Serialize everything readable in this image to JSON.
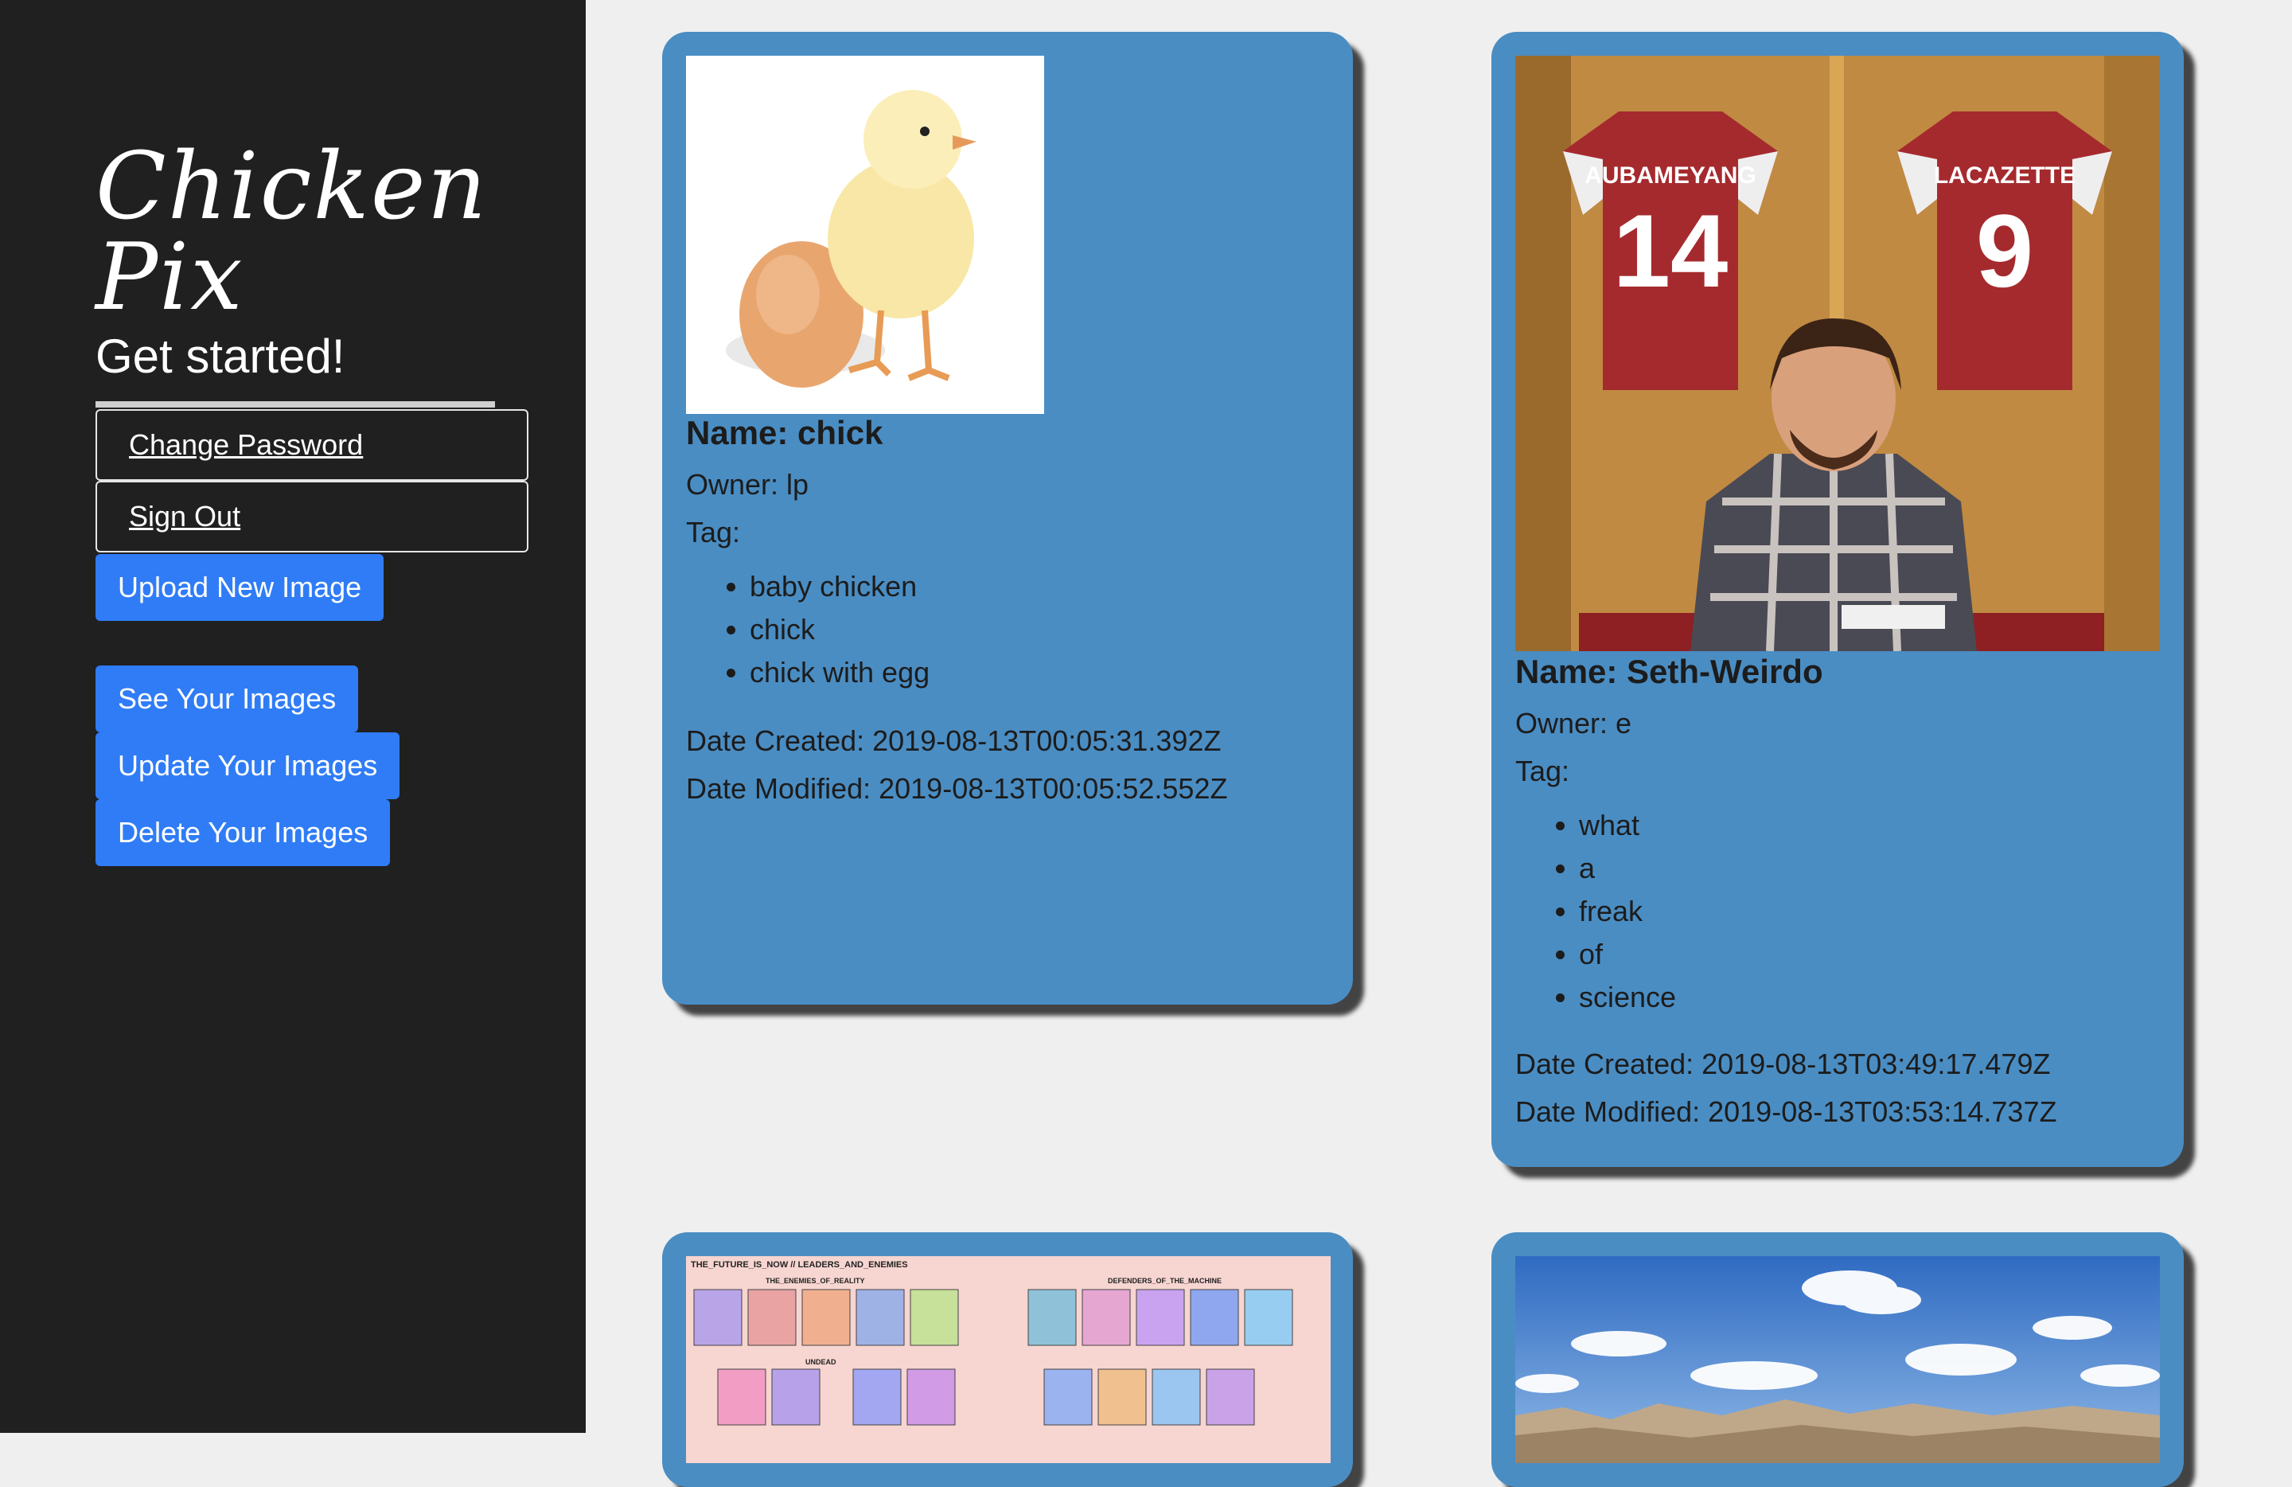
{
  "sidebar": {
    "logo": "Chicken Pix",
    "heading": "Get started!",
    "change_password": "Change Password",
    "sign_out": "Sign Out",
    "upload": "Upload New Image",
    "see": "See Your Images",
    "update": "Update Your Images",
    "delete": "Delete Your Images"
  },
  "cards": [
    {
      "name": "Name: chick",
      "owner": "Owner: lp",
      "tag_label": "Tag:",
      "tags": [
        "baby chicken",
        "chick",
        "chick with egg"
      ],
      "created": "Date Created: 2019-08-13T00:05:31.392Z",
      "modified": "Date Modified: 2019-08-13T00:05:52.552Z"
    },
    {
      "name": "Name: Seth-Weirdo",
      "owner": "Owner: e",
      "tag_label": "Tag:",
      "tags": [
        "what",
        "a",
        "freak",
        "of",
        "science"
      ],
      "created": "Date Created: 2019-08-13T03:49:17.479Z",
      "modified": "Date Modified: 2019-08-13T03:53:14.737Z",
      "photo": {
        "jersey_left_name": "AUBAMEYANG",
        "jersey_left_number": "14",
        "jersey_right_name": "LACAZETTE",
        "jersey_right_number": "9"
      }
    },
    {
      "poster": {
        "title": "THE_FUTURE_IS_NOW // LEADERS_AND_ENEMIES",
        "left_heading": "THE_ENEMIES_OF_REALITY",
        "right_heading": "DEFENDERS_OF_THE_MACHINE",
        "mid_heading": "UNDEAD"
      }
    },
    {}
  ],
  "colors": {
    "sidebar": "#202020",
    "card": "#4a8dc3",
    "button": "#2f7cf6",
    "background": "#efefef"
  }
}
